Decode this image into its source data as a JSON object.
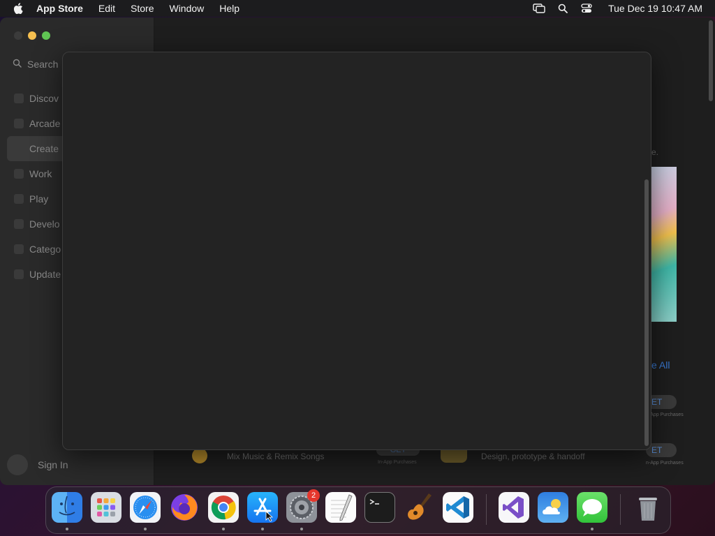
{
  "menubar": {
    "apple_icon": "apple-logo-icon",
    "app_name": "App Store",
    "menus": [
      "Edit",
      "Store",
      "Window",
      "Help"
    ],
    "status_icons": [
      "screen-mirroring-icon",
      "spotlight-search-icon",
      "control-center-icon"
    ],
    "clock": "Tue Dec 19  10:47 AM"
  },
  "sidebar": {
    "search_placeholder": "Search",
    "items": [
      {
        "label": "Discov"
      },
      {
        "label": "Arcade"
      },
      {
        "label": "Create"
      },
      {
        "label": "Work"
      },
      {
        "label": "Play"
      },
      {
        "label": "Develo"
      },
      {
        "label": "Catego"
      },
      {
        "label": "Update"
      }
    ],
    "active_index": 2,
    "signin_label": "Sign In"
  },
  "main": {
    "hint_text": "e.",
    "see_all": "e All",
    "get_label_1": "ET",
    "get_label_2": "ET",
    "iap_label": "n-App Purchases",
    "row": {
      "get_label": "GET",
      "iap_label": "In-App Purchases",
      "subtitle_1": "Mix Music & Remix Songs",
      "subtitle_2": "Design, prototype & handoff"
    }
  },
  "dock": {
    "apps": [
      {
        "name": "Finder",
        "icon": "finder-icon",
        "running": true
      },
      {
        "name": "Launchpad",
        "icon": "launchpad-icon",
        "running": false
      },
      {
        "name": "Safari",
        "icon": "safari-icon",
        "running": true
      },
      {
        "name": "Firefox",
        "icon": "firefox-icon",
        "running": false
      },
      {
        "name": "Chrome",
        "icon": "chrome-icon",
        "running": true
      },
      {
        "name": "App Store",
        "icon": "app-store-icon",
        "running": true
      },
      {
        "name": "System Settings",
        "icon": "system-settings-icon",
        "running": true,
        "badge": "2"
      },
      {
        "name": "TextEdit",
        "icon": "textedit-icon",
        "running": false
      },
      {
        "name": "Terminal",
        "icon": "terminal-icon",
        "running": false
      },
      {
        "name": "GarageBand",
        "icon": "garageband-icon",
        "running": false
      },
      {
        "name": "VS Code",
        "icon": "vscode-icon",
        "running": false
      },
      {
        "name": "Visual Studio",
        "icon": "visual-studio-icon",
        "running": false
      },
      {
        "name": "Weather",
        "icon": "weather-icon",
        "running": false
      },
      {
        "name": "Messages",
        "icon": "messages-icon",
        "running": true
      },
      {
        "name": "Trash",
        "icon": "trash-icon",
        "running": false
      }
    ]
  }
}
